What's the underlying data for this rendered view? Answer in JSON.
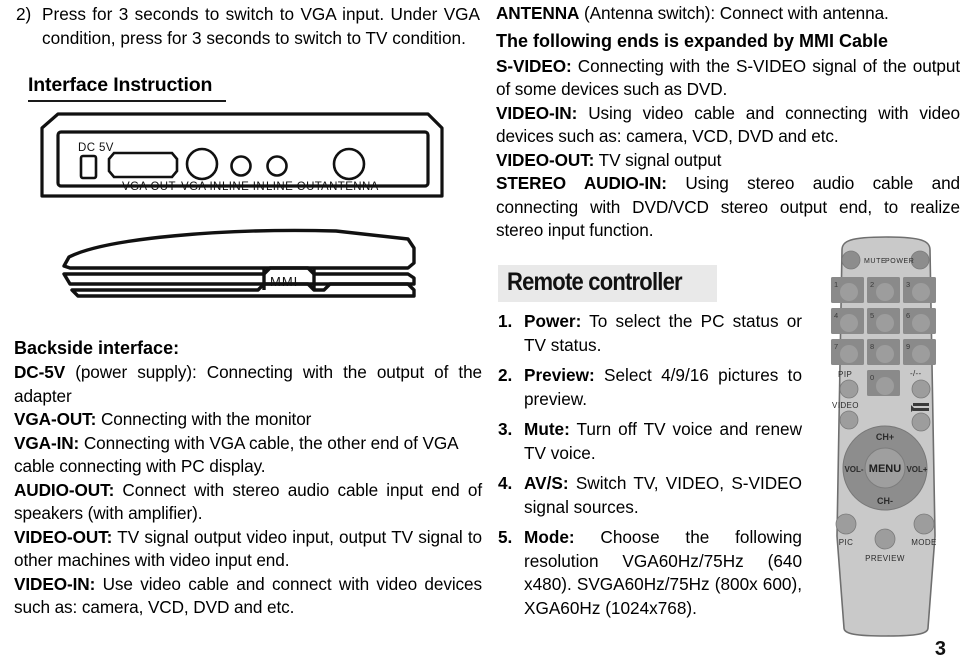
{
  "page": {
    "number": "3"
  },
  "left_column": {
    "step": {
      "marker": "2)",
      "text": "Press for 3 seconds to switch to VGA input. Under VGA condition, press for 3 seconds to switch to TV condition."
    },
    "interface_heading": "Interface Instruction",
    "device_figure": {
      "back_panel_labels": [
        "DC 5V",
        "VGA OUT",
        "VGA IN",
        "LINE IN",
        "LINE OUT",
        "ANTENNA"
      ],
      "front_panel_label": "MMI"
    },
    "backside_heading": "Backside interface:",
    "entries": [
      {
        "term": "DC-5V",
        "rest": " (power supply): Connecting with the output of the adapter"
      },
      {
        "term": "VGA-OUT:",
        "rest": " Connecting with the monitor"
      },
      {
        "term": "VGA-IN:",
        "rest": " Connecting with VGA cable, the other end of VGA cable connecting with PC display."
      },
      {
        "term": "AUDIO-OUT:",
        "rest": " Connect with stereo audio cable input end of speakers (with amplifier)."
      },
      {
        "term": "VIDEO-OUT:",
        "rest": " TV signal output video input, output TV signal to other machines with video input end."
      },
      {
        "term": "VIDEO-IN:",
        "rest": " Use video cable and connect with video devices such as: camera, VCD, DVD and etc."
      }
    ]
  },
  "right_column": {
    "antenna_entry": {
      "term": "ANTENNA",
      "rest": " (Antenna switch): Connect with antenna."
    },
    "mmi_heading": "The following ends is expanded by MMI Cable",
    "entries": [
      {
        "term": "S-VIDEO:",
        "rest": " Connecting with the S-VIDEO signal of the output of some devices such as DVD."
      },
      {
        "term": "VIDEO-IN:",
        "rest": " Using video cable and connecting with video devices such as: camera, VCD, DVD and etc."
      },
      {
        "term": "VIDEO-OUT:",
        "rest": " TV signal output"
      },
      {
        "term": "STEREO AUDIO-IN:",
        "rest": " Using stereo audio cable and connecting with DVD/VCD stereo output end, to realize stereo input function."
      }
    ],
    "remote_banner": "Remote controller",
    "remote_items": [
      {
        "num": "1.",
        "term": "Power:",
        "rest": " To select the PC status or TV status."
      },
      {
        "num": "2.",
        "term": "Preview:",
        "rest": " Select 4/9/16 pictures to preview."
      },
      {
        "num": "3.",
        "term": "Mute:",
        "rest": " Turn off TV voice and renew TV voice."
      },
      {
        "num": "4.",
        "term": "AV/S:",
        "rest": " Switch TV, VIDEO, S-VIDEO signal sources."
      },
      {
        "num": "5.",
        "term": "Mode:",
        "rest": " Choose the following resolution VGA60Hz/75Hz (640 x480). SVGA60Hz/75Hz (800x 600), XGA60Hz (1024x768)."
      }
    ],
    "remote_figure": {
      "buttons": [
        "MUTE",
        "POWER",
        "1",
        "2",
        "3",
        "4",
        "5",
        "6",
        "7",
        "8",
        "9",
        "PIP",
        "0",
        "-/--",
        "VIDEO",
        "CH+",
        "VOL-",
        "MENU",
        "VOL+",
        "CH-",
        "PIC",
        "PREVIEW",
        "MODE"
      ]
    }
  },
  "colors": {
    "banner_background": "#e9e9e9",
    "text": "#000000",
    "remote_body": "#c9c9c9",
    "remote_key": "#8d8d8d",
    "remote_pad": "#9a9a9a"
  }
}
